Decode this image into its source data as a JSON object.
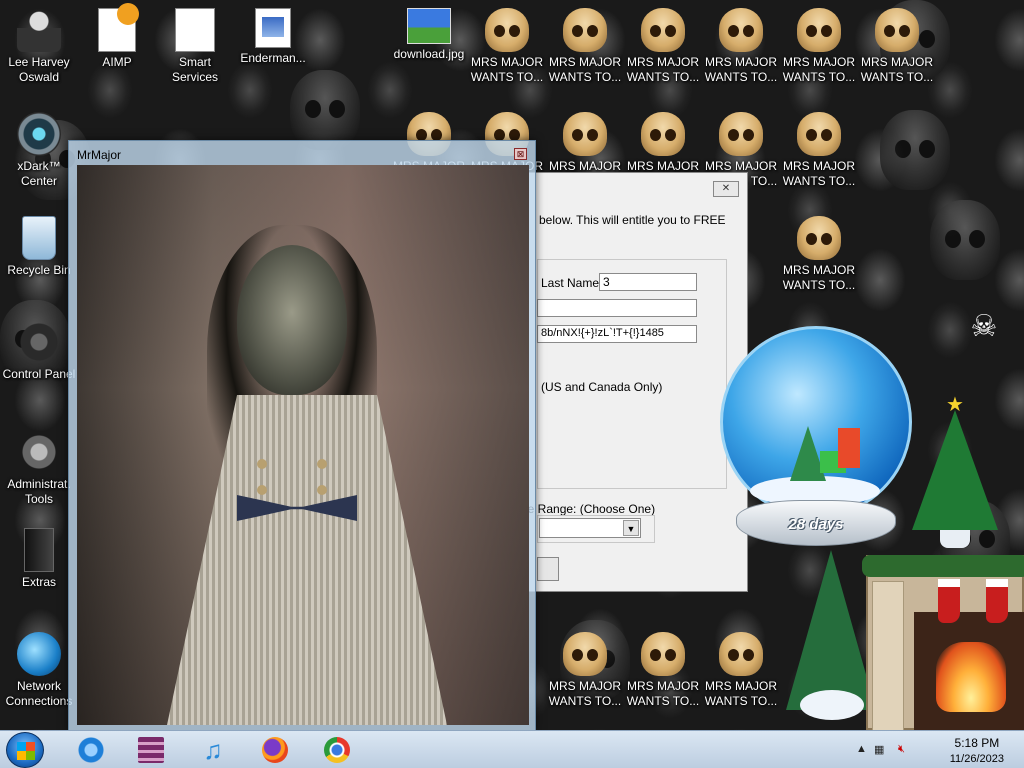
{
  "desktop": {
    "left_icons": [
      {
        "name": "lee-harvey-oswald",
        "label": "Lee Harvey\nOswald",
        "icon": "person-icon"
      },
      {
        "name": "xdark-center",
        "label": "xDark™\nCenter",
        "icon": "xdark-icon"
      },
      {
        "name": "recycle-bin",
        "label": "Recycle Bin",
        "icon": "recycle-bin-icon"
      },
      {
        "name": "control-panel",
        "label": "Control Panel",
        "icon": "control-panel-icon"
      },
      {
        "name": "administrative-tools",
        "label": "Administrat.\nTools",
        "icon": "admin-tools-icon"
      },
      {
        "name": "extras",
        "label": "Extras",
        "icon": "folder-icon"
      },
      {
        "name": "network-connections",
        "label": "Network\nConnections",
        "icon": "network-icon"
      }
    ],
    "top_icons": [
      {
        "label": "AIMP"
      },
      {
        "label": "Smart\nServices"
      },
      {
        "label": "Enderman..."
      },
      {
        "label": "download.jpg"
      }
    ],
    "skull_icon_label": "MRS MAJOR\nWANTS TO...",
    "skull_icon_label_short": "WANTS TO..."
  },
  "mrmajor_window": {
    "title": "MrMajor",
    "close_glyph": "⊠"
  },
  "registration_dialog": {
    "close_glyph": "✕",
    "intro_text": "below.  This will entitle you to FREE",
    "last_name_label": "Last Name:",
    "last_name_value": "3",
    "field2_value": "",
    "garbled_value": "8b/nNX!{+}!zL`!T+{!}1485",
    "country_text": "(US and Canada Only)",
    "range_label": "ge Range: (Choose One)",
    "range_selected": ""
  },
  "snow_globe": {
    "days_text": "28 days"
  },
  "taskbar": {
    "pinned": [
      {
        "name": "taskbar-internet-explorer",
        "icon": "internet-explorer-icon",
        "color": "#1e7fd8"
      },
      {
        "name": "taskbar-winrar",
        "icon": "winrar-icon",
        "color": "#7a2a6a"
      },
      {
        "name": "taskbar-music",
        "icon": "music-note-icon",
        "color": "#2a8ad8"
      },
      {
        "name": "taskbar-firefox",
        "icon": "firefox-icon",
        "color": "#e8661c"
      },
      {
        "name": "taskbar-chrome",
        "icon": "chrome-icon",
        "color": "#2a9a3a"
      }
    ],
    "time": "5:18 PM",
    "date": "11/26/2023"
  }
}
